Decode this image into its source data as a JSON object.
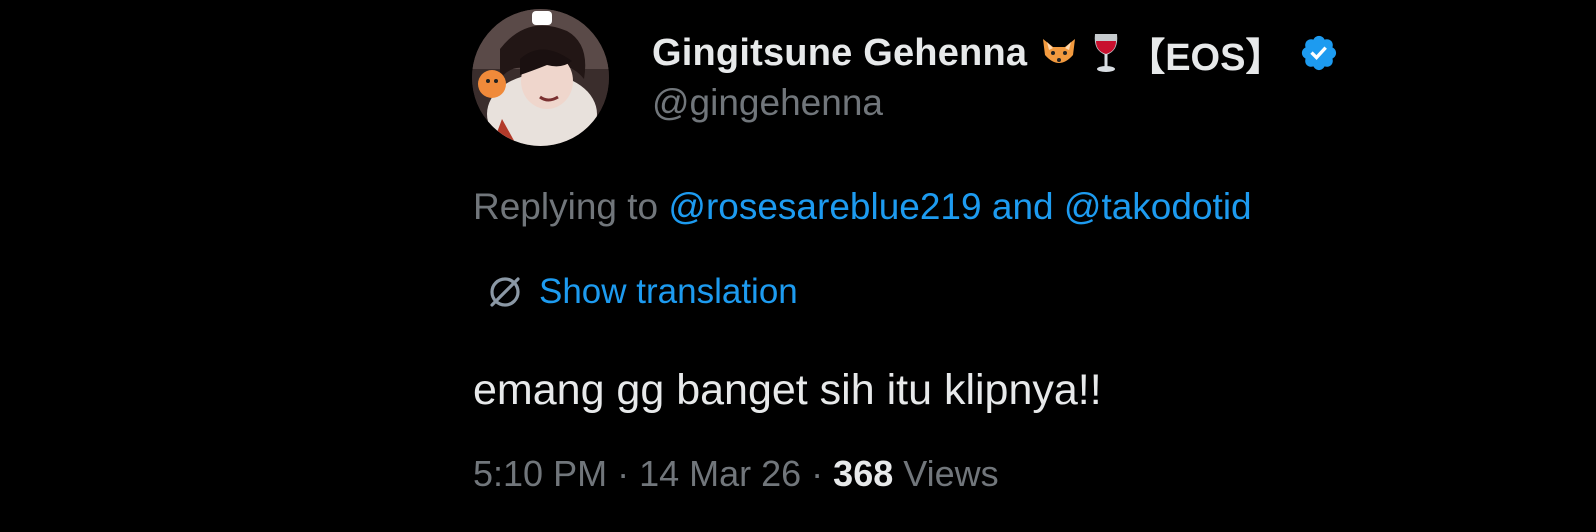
{
  "author": {
    "display_name": "Gingitsune Gehenna",
    "emojis": [
      "fox-emoji",
      "wine-glass-emoji"
    ],
    "tag": "【EOS】",
    "verified": true,
    "handle": "@gingehenna",
    "avatar": "avatar-anime-character"
  },
  "reply": {
    "prefix": "Replying to ",
    "mention_1": "@rosesareblue219",
    "conjunction": " and ",
    "mention_2": "@takodotid"
  },
  "translation": {
    "icon": "globe-slash-icon",
    "label": "Show translation"
  },
  "tweet": {
    "text": "emang gg banget sih itu klipnya!!"
  },
  "meta": {
    "time": "5:10 PM",
    "separator": " · ",
    "date": "14 Mar 26",
    "views_count": "368",
    "views_label": " Views"
  },
  "colors": {
    "background": "#000000",
    "text_primary": "#e7e9ea",
    "text_secondary": "#71767b",
    "accent": "#1d9bf0"
  }
}
